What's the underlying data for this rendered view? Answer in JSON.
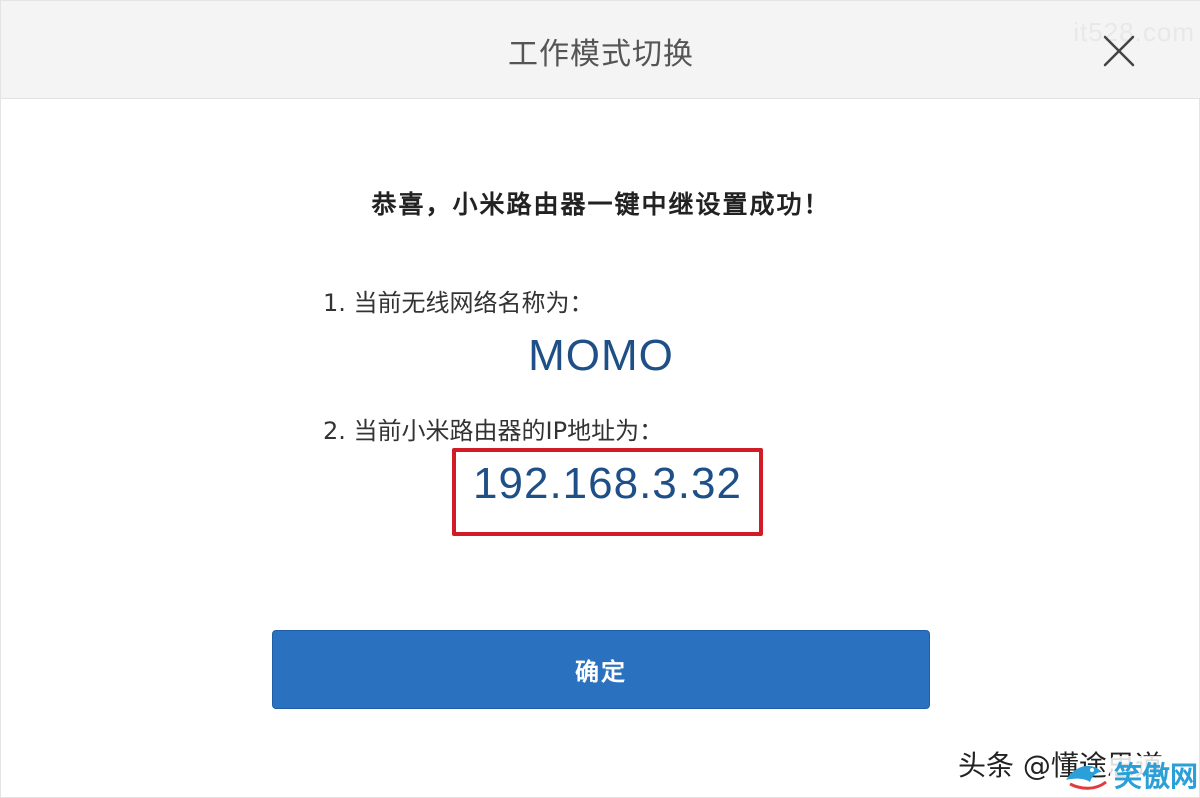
{
  "dialog": {
    "title": "工作模式切换",
    "watermark": "it528.com",
    "close_icon": "close-icon",
    "success_message": "恭喜，小米路由器一键中继设置成功！",
    "line1_label": "1. 当前无线网络名称为：",
    "ssid": "MOMO",
    "line2_label": "2. 当前小米路由器的IP地址为：",
    "ip_address": "192.168.3.32",
    "confirm_label": "确定"
  },
  "overlay": {
    "attribution": "头条 @懂途思道",
    "site_logo": "笑傲网"
  },
  "colors": {
    "title_bar": "#f4f4f4",
    "value_text": "#1e4f86",
    "highlight_border": "#d11b26",
    "button": "#2a72c0"
  }
}
